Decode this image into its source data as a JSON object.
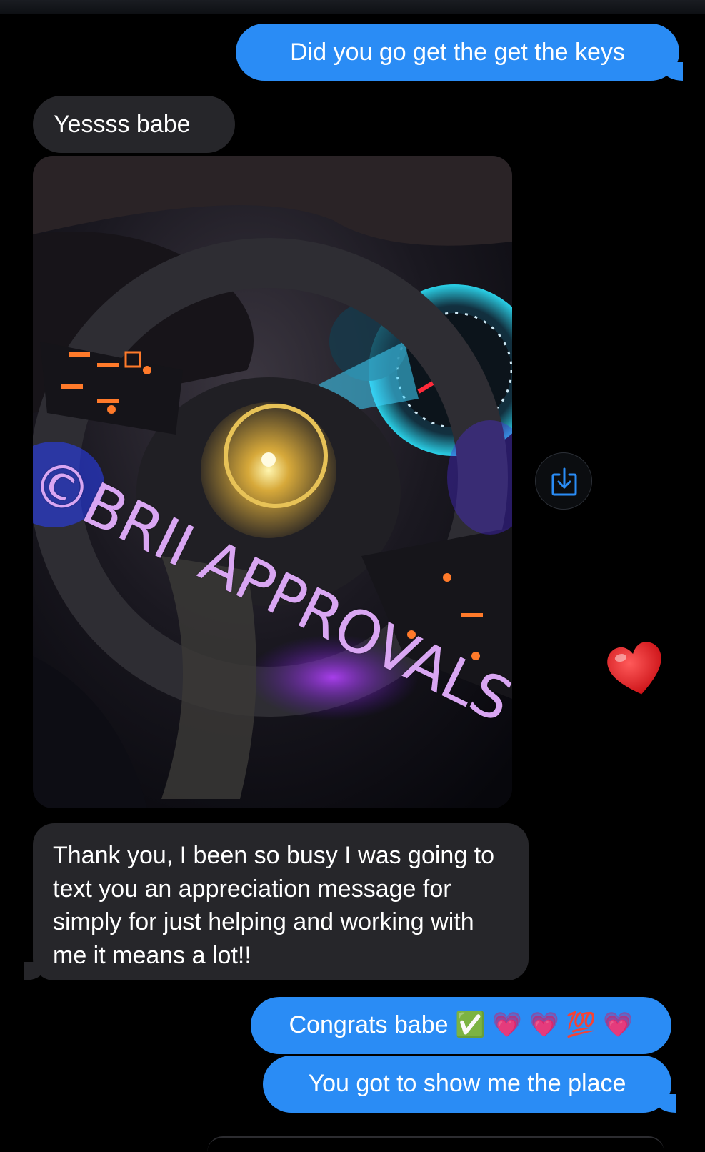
{
  "messages": [
    {
      "from": "me",
      "text": "Did you go get the get the keys"
    },
    {
      "from": "them",
      "text": "Yessss babe"
    },
    {
      "from": "them",
      "type": "photo",
      "watermark": "©BRII APPROVALS",
      "sticker": "heart-emoji"
    },
    {
      "from": "them",
      "text": "Thank you, I been so busy I was going to text you an appreciation message for simply for just helping and working with me it means a lot!!"
    },
    {
      "from": "me",
      "text": "Congrats babe",
      "emoji": [
        "✅",
        "💗",
        "💗",
        "💯",
        "💗"
      ]
    },
    {
      "from": "me",
      "text": "You got to show me the place"
    }
  ],
  "actions": {
    "save_icon": "save-to-photos-icon"
  },
  "colors": {
    "sent_bubble": "#2a8cf5",
    "received_bubble": "#26262a",
    "background": "#000000",
    "watermark": "#d9a6f2",
    "heart": "#e0151b"
  }
}
